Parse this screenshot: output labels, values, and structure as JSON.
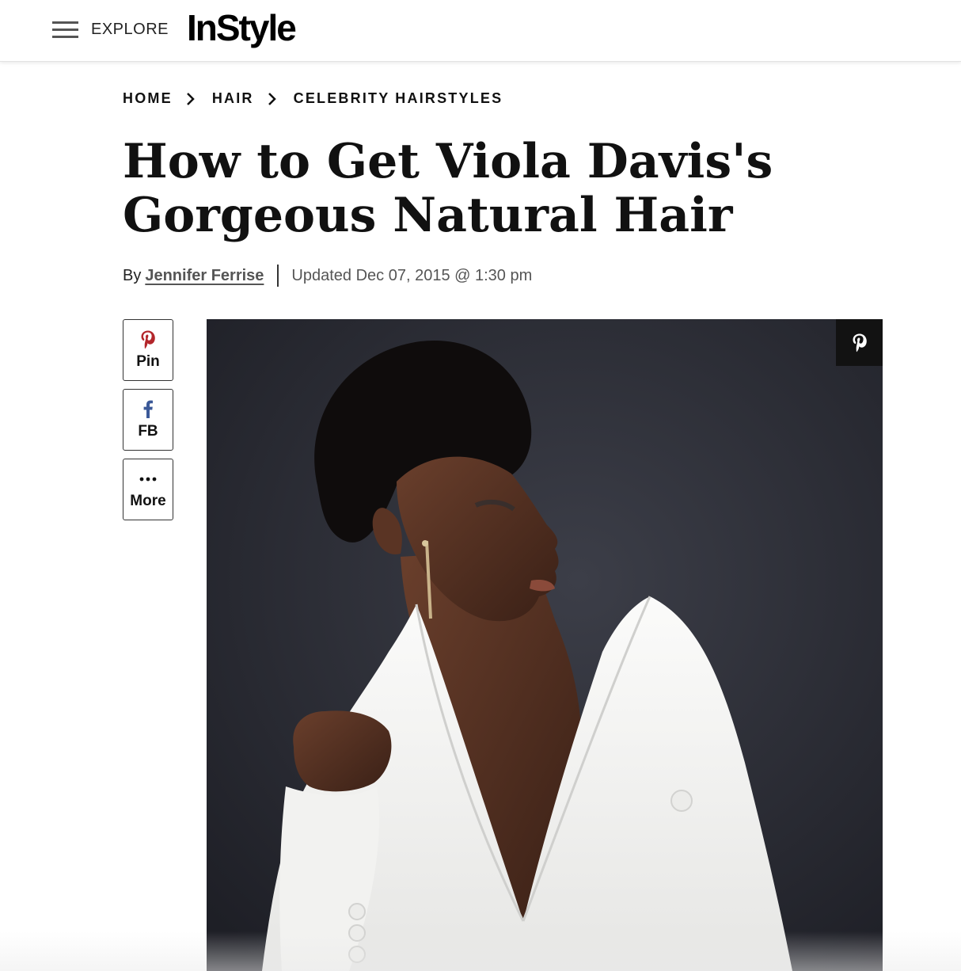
{
  "header": {
    "menu_label": "EXPLORE",
    "logo_text": "InStyle"
  },
  "breadcrumb": {
    "items": [
      "HOME",
      "HAIR",
      "CELEBRITY HAIRSTYLES"
    ]
  },
  "article": {
    "title_line1": "How to Get Viola Davis's",
    "title_line2": "Gorgeous Natural Hair",
    "by_prefix": "By",
    "author": "Jennifer Ferrise",
    "updated": "Updated Dec 07, 2015 @ 1:30 pm"
  },
  "share": {
    "pin_label": "Pin",
    "fb_label": "FB",
    "more_label": "More",
    "pin_color": "#b3262b",
    "fb_color": "#3b5998"
  },
  "hero": {
    "icon": "pinterest-icon",
    "background_color": "#2a2b33",
    "jacket_color": "#f4f4f2"
  }
}
